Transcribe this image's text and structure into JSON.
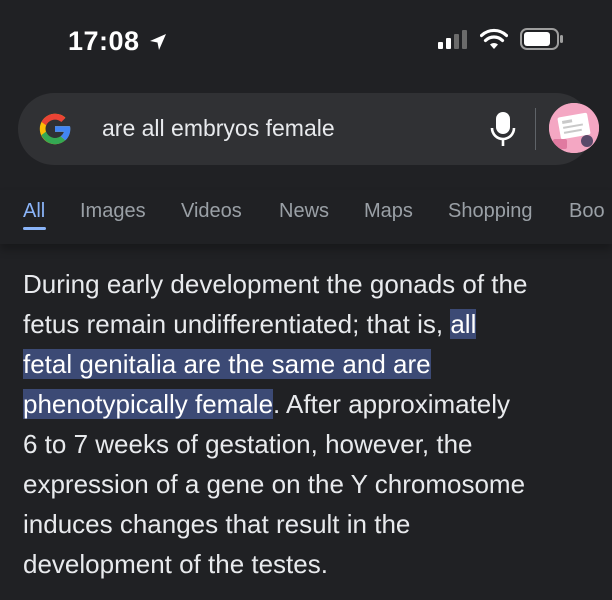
{
  "status_bar": {
    "time": "17:08",
    "icons": [
      "location-arrow-icon",
      "cellular-signal-icon",
      "wifi-icon",
      "battery-icon"
    ]
  },
  "search": {
    "logo_icon": "google-g-icon",
    "query": "are all embryos female",
    "mic_icon": "microphone-icon",
    "avatar_icon": "account-avatar"
  },
  "tabs": {
    "items": [
      "All",
      "Images",
      "Videos",
      "News",
      "Maps",
      "Shopping",
      "Boo"
    ],
    "active": "All"
  },
  "answer": {
    "line1": "During early development the gonads of the",
    "line2_pre": "fetus remain undifferentiated; that is, ",
    "line2_hl": "all",
    "line3_hl": "fetal genitalia are the same and are",
    "line4_hl": "phenotypically female",
    "line4_post": ". After approximately",
    "line5": "6 to 7 weeks of gestation, however, the",
    "line6": "expression of a gene on the Y chromosome",
    "line7": "induces changes that result in the",
    "line8": "development of the testes."
  },
  "colors": {
    "background": "#202124",
    "search_bg": "#303134",
    "accent_blue": "#8ab4f8",
    "highlight": "#3c4a75"
  }
}
